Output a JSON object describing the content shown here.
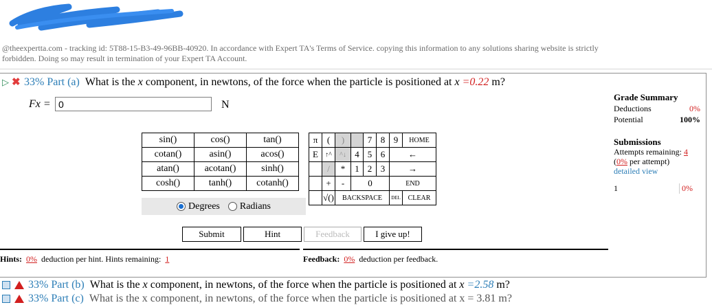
{
  "watermark": {
    "line1": "@theexpertta.com - tracking id: 5T88-15-B3-49-96BB-40920. In accordance with Expert TA's Terms of Service. copying this information to any solutions sharing website is strictly",
    "line2": "forbidden. Doing so may result in termination of your Expert TA Account."
  },
  "part_a": {
    "percent": "33%",
    "label": "Part (a)",
    "question_pre": "What is the",
    "var": "x",
    "question_mid": "component, in newtons, of the force when the particle is positioned at",
    "eq": "=",
    "value": "0.22",
    "unit": "m?",
    "answer_label": "Fx =",
    "answer_value": "0",
    "answer_unit": "N"
  },
  "grade_summary": {
    "title": "Grade Summary",
    "deductions_label": "Deductions",
    "deductions_value": "0%",
    "potential_label": "Potential",
    "potential_value": "100%"
  },
  "submissions": {
    "title": "Submissions",
    "attempts_label": "Attempts remaining:",
    "attempts_value": "4",
    "per_attempt_pct": "0%",
    "per_attempt_label": "per attempt)",
    "detailed_view": "detailed view",
    "row_num": "1",
    "row_pct": "0%"
  },
  "functions": [
    [
      "sin()",
      "cos()",
      "tan()"
    ],
    [
      "cotan()",
      "asin()",
      "acos()"
    ],
    [
      "atan()",
      "acotan()",
      "sinh()"
    ],
    [
      "cosh()",
      "tanh()",
      "cotanh()"
    ]
  ],
  "angle": {
    "degrees": "Degrees",
    "radians": "Radians",
    "selected": "Degrees"
  },
  "keypad": {
    "pi": "π",
    "lparen": "(",
    "rparen": ")",
    "k7": "7",
    "k8": "8",
    "k9": "9",
    "home": "HOME",
    "e": "E",
    "up": "↑^",
    "updown": "^↓",
    "k4": "4",
    "k5": "5",
    "k6": "6",
    "left": "←",
    "div": "/",
    "mul": "*",
    "k1": "1",
    "k2": "2",
    "k3": "3",
    "right": "→",
    "plus": "+",
    "minus": "-",
    "k0": "0",
    "end": "END",
    "sqrt": "√()",
    "backspace": "BACKSPACE",
    "del": "DEL",
    "clear": "CLEAR"
  },
  "buttons": {
    "submit": "Submit",
    "hint": "Hint",
    "feedback": "Feedback",
    "give_up": "I give up!"
  },
  "hints": {
    "label": "Hints:",
    "pct": "0%",
    "text": "deduction per hint. Hints remaining:",
    "remaining": "1"
  },
  "feedback": {
    "label": "Feedback:",
    "pct": "0%",
    "text": "deduction per feedback."
  },
  "part_b": {
    "percent": "33%",
    "label": "Part (b)",
    "question_pre": "What is the",
    "var": "x",
    "question_mid": "component, in newtons, of the force when the particle is positioned at",
    "eq": "=",
    "value": "2.58",
    "unit": "m?"
  },
  "part_c": {
    "percent": "33%",
    "label": "Part (c)",
    "question": "What is the x component, in newtons, of the force when the particle is positioned at x = 3.81 m?"
  },
  "colors": {
    "link": "#2b7db6",
    "red": "#d21f1f",
    "green": "#2e8b57"
  }
}
